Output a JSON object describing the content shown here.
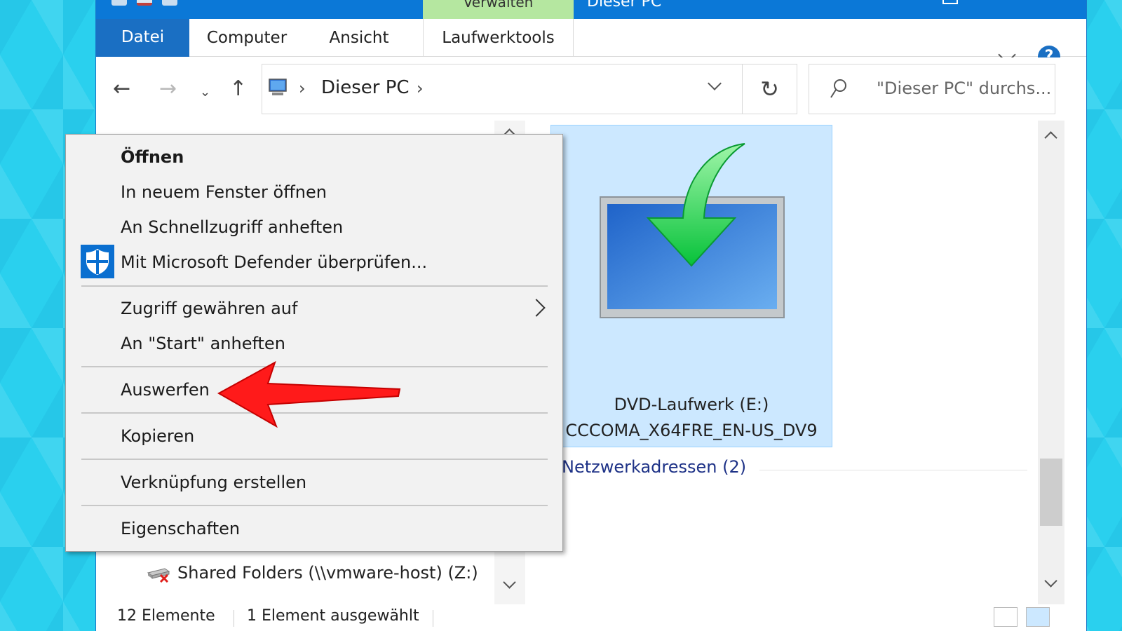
{
  "window": {
    "title": "Dieser PC",
    "contextual_group": "Verwalten"
  },
  "ribbon": {
    "tabs": [
      {
        "label": "Datei"
      },
      {
        "label": "Computer"
      },
      {
        "label": "Ansicht"
      },
      {
        "label": "Laufwerktools"
      }
    ],
    "help_label": "?"
  },
  "navigation": {
    "back_icon": "arrow-left-icon",
    "forward_icon": "arrow-right-icon",
    "recent_icon": "chevron-down-icon",
    "up_icon": "arrow-up-icon",
    "breadcrumb": [
      "Dieser PC"
    ],
    "refresh_icon": "refresh-icon",
    "search_placeholder": "\"Dieser PC\" durchs..."
  },
  "nav_pane": {
    "items": [
      {
        "label": "Shared Folders (\\\\vmware-host) (Z:)",
        "icon": "disconnected-network-drive-icon"
      }
    ]
  },
  "content": {
    "selected_item": {
      "name_line1": "DVD-Laufwerk (E:)",
      "name_line2": "CCCOMA_X64FRE_EN-US_DV9",
      "icon": "dvd-install-icon"
    },
    "section_header": "Netzwerkadressen (2)"
  },
  "context_menu": {
    "items": [
      {
        "label": "Öffnen",
        "bold": true
      },
      {
        "label": "In neuem Fenster öffnen"
      },
      {
        "label": "An Schnellzugriff anheften"
      },
      {
        "label": "Mit Microsoft Defender überprüfen...",
        "icon": "defender-shield-icon"
      },
      {
        "label": "Zugriff gewähren auf",
        "submenu": true
      },
      {
        "label": "An \"Start\" anheften"
      },
      {
        "label": "Auswerfen",
        "highlighted_by_annotation": true
      },
      {
        "label": "Kopieren"
      },
      {
        "label": "Verknüpfung erstellen"
      },
      {
        "label": "Eigenschaften"
      }
    ]
  },
  "statusbar": {
    "item_count": "12 Elemente",
    "selection": "1 Element ausgewählt"
  },
  "annotation": {
    "type": "arrow",
    "color": "#ff0000",
    "points_to": "Auswerfen"
  },
  "colors": {
    "accent": "#1a6fc3",
    "titlebar": "#0b78d7",
    "contextual_tab": "#b5e7a0",
    "selection": "#cce8ff",
    "menu_background": "#f2f2f2"
  }
}
